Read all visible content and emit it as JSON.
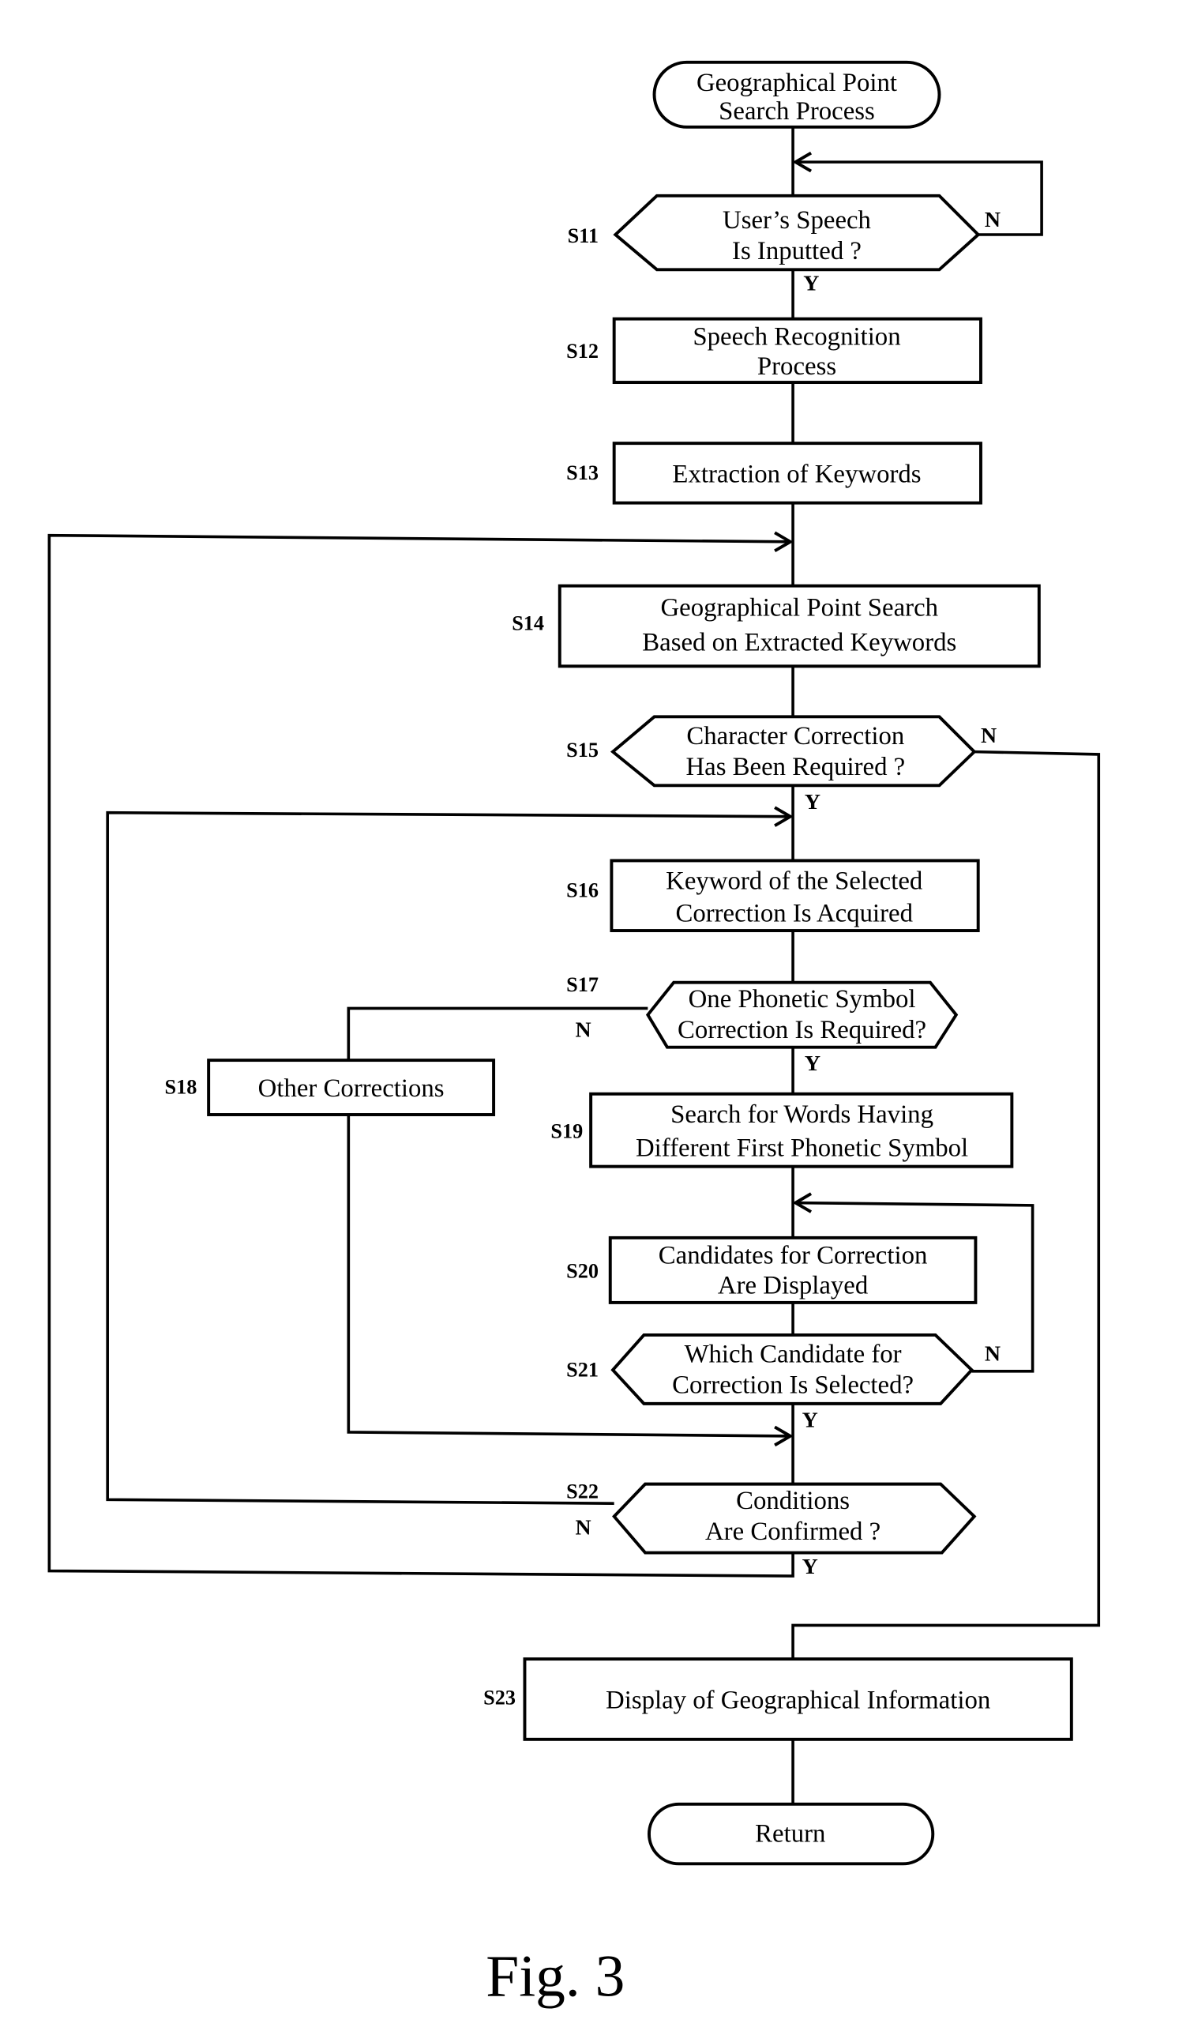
{
  "figure_label": "Fig. 3",
  "start": {
    "line1": "Geographical Point",
    "line2": "Search Process"
  },
  "end": {
    "label": "Return"
  },
  "steps": {
    "s11": {
      "id": "S11",
      "line1": "User’s Speech",
      "line2": "Is Inputted ?",
      "yes": "Y",
      "no": "N"
    },
    "s12": {
      "id": "S12",
      "line1": "Speech Recognition",
      "line2": "Process"
    },
    "s13": {
      "id": "S13",
      "line1": "Extraction of Keywords"
    },
    "s14": {
      "id": "S14",
      "line1": "Geographical Point Search",
      "line2": "Based on Extracted Keywords"
    },
    "s15": {
      "id": "S15",
      "line1": "Character Correction",
      "line2": "Has Been Required ?",
      "yes": "Y",
      "no": "N"
    },
    "s16": {
      "id": "S16",
      "line1": "Keyword of the Selected",
      "line2": "Correction Is Acquired"
    },
    "s17": {
      "id": "S17",
      "line1": "One Phonetic Symbol",
      "line2": "Correction Is Required?",
      "yes": "Y",
      "no": "N"
    },
    "s18": {
      "id": "S18",
      "line1": "Other Corrections"
    },
    "s19": {
      "id": "S19",
      "line1": "Search for Words Having",
      "line2": "Different First Phonetic Symbol"
    },
    "s20": {
      "id": "S20",
      "line1": "Candidates for Correction",
      "line2": "Are Displayed"
    },
    "s21": {
      "id": "S21",
      "line1": "Which Candidate for",
      "line2": "Correction Is Selected?",
      "yes": "Y",
      "no": "N"
    },
    "s22": {
      "id": "S22",
      "line1": "Conditions",
      "line2": "Are Confirmed ?",
      "yes": "Y",
      "no": "N"
    },
    "s23": {
      "id": "S23",
      "line1": "Display of Geographical Information"
    }
  }
}
